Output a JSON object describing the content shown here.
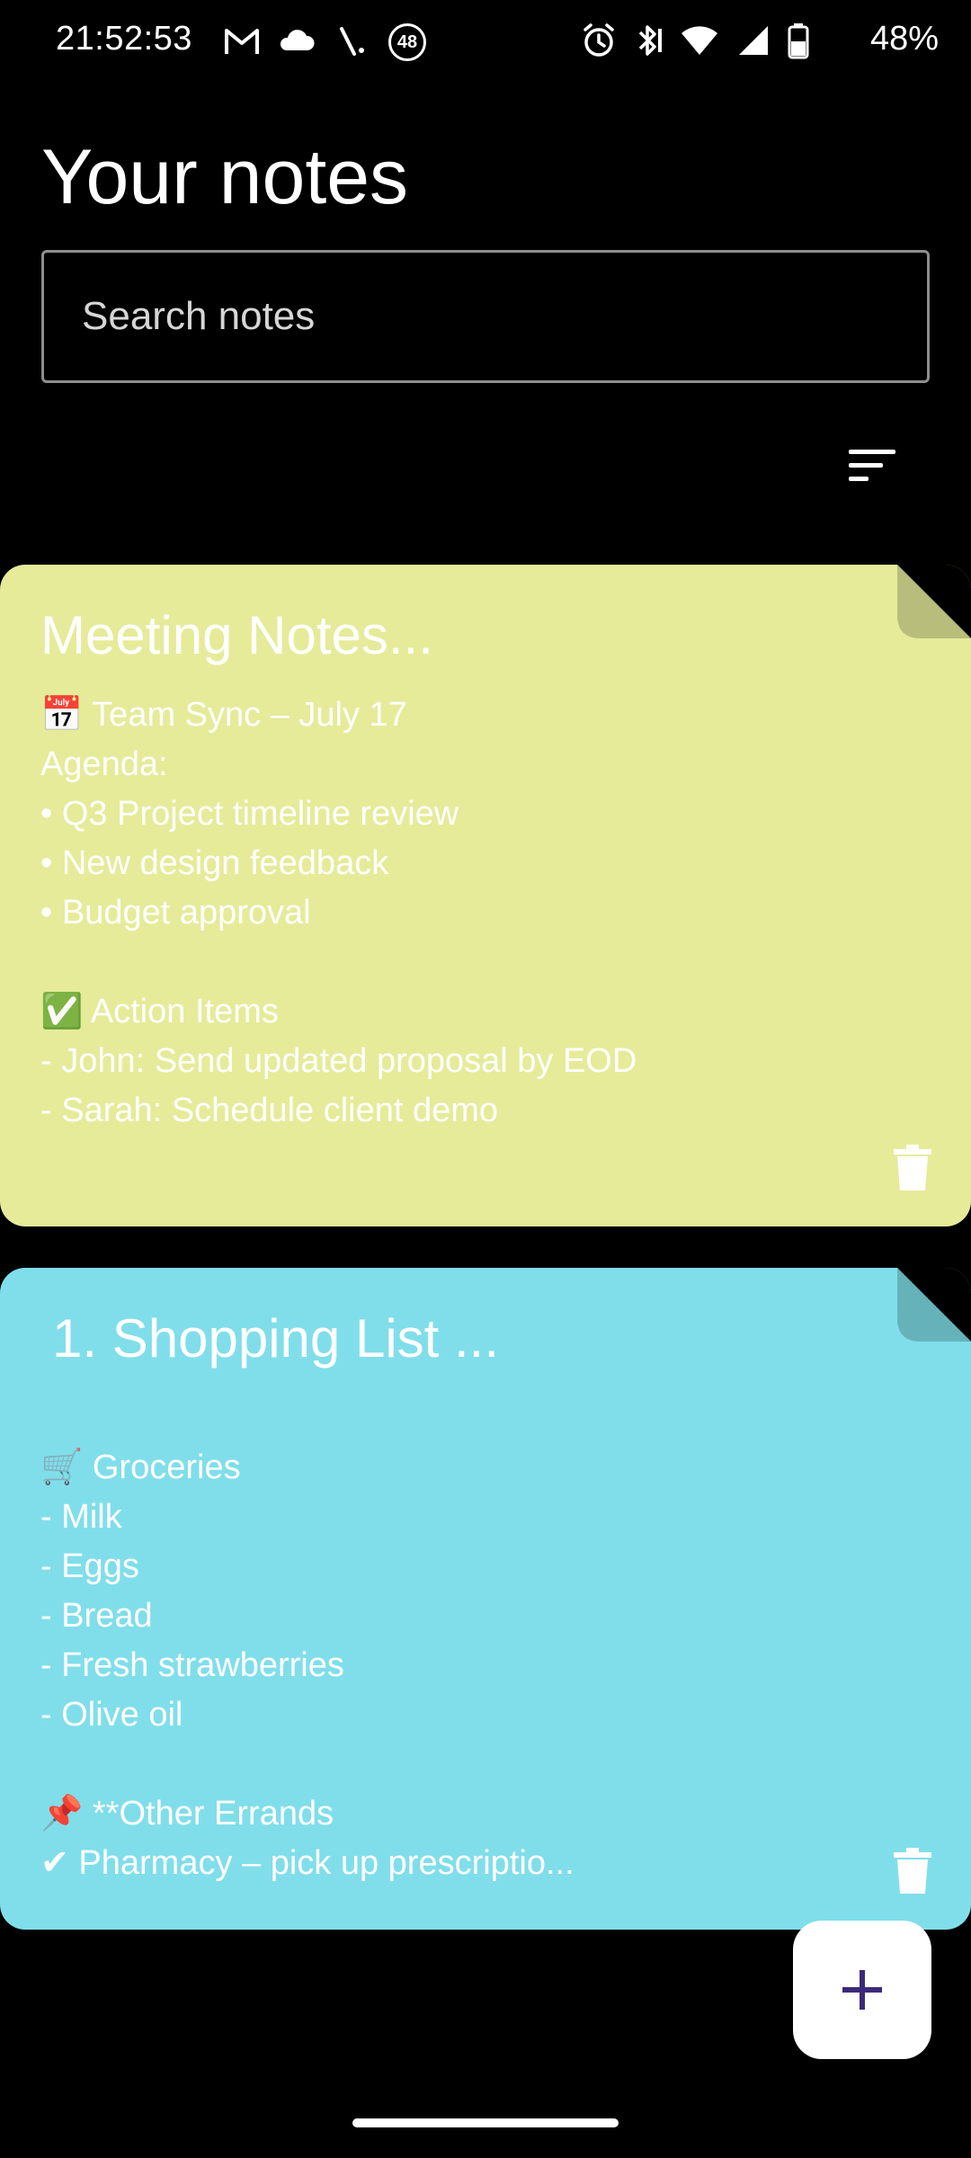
{
  "status_bar": {
    "time": "21:52:53",
    "battery": "48%",
    "notification_badge": "48"
  },
  "header": {
    "title": "Your notes"
  },
  "search": {
    "placeholder": "Search notes",
    "value": ""
  },
  "notes": [
    {
      "title": "Meeting Notes...",
      "body": "📅 Team Sync – July 17\nAgenda:\n• Q3 Project timeline review\n• New design feedback\n• Budget approval\n\n✅ Action Items\n- John: Send updated proposal by EOD\n- Sarah: Schedule client demo",
      "color": "#e6eb9a",
      "fold_color": "#b8bd7c"
    },
    {
      "title": "1. Shopping List ...",
      "body": "\n🛒 Groceries\n- Milk\n- Eggs\n- Bread\n- Fresh strawberries\n- Olive oil\n\n📌 **Other Errands\n✔ Pharmacy – pick up prescriptio...",
      "color": "#80deea",
      "fold_color": "#66b2bb"
    }
  ],
  "icons": {
    "sort": "sort-icon",
    "delete": "trash-icon",
    "add": "plus-icon"
  },
  "colors": {
    "fab_icon": "#3b2a7a"
  }
}
